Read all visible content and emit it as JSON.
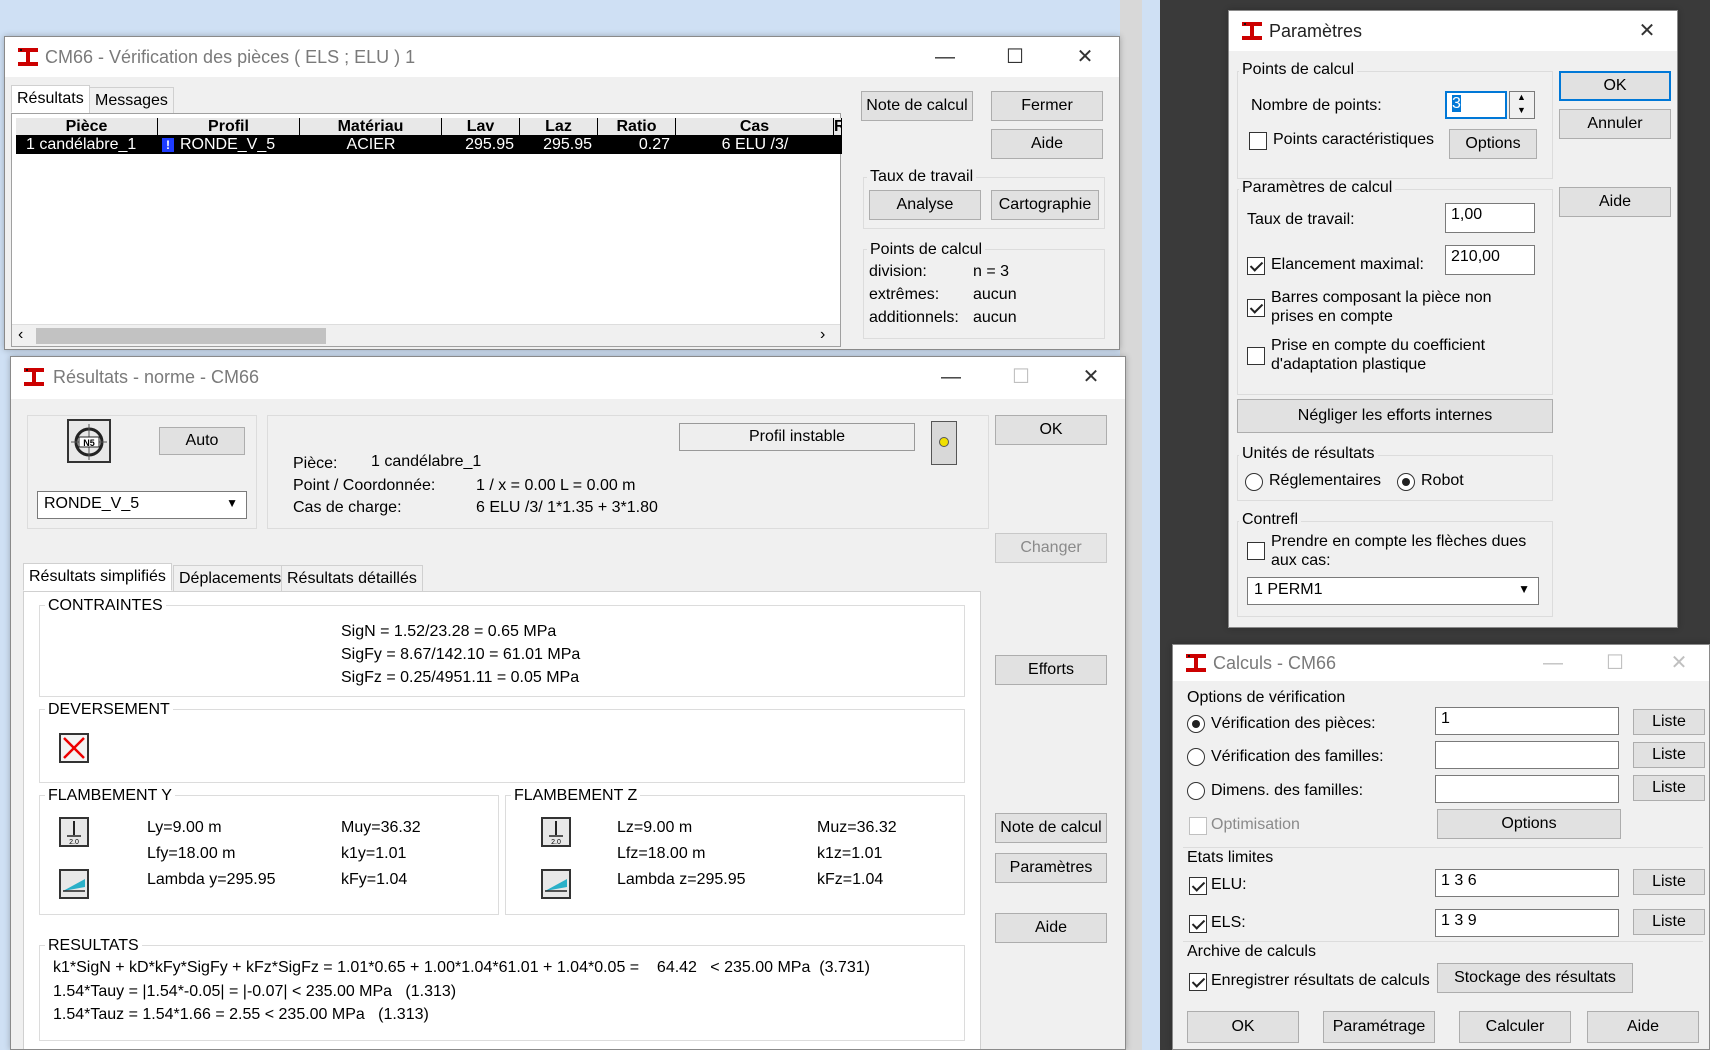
{
  "verif_window": {
    "title": "CM66 - Vérification des pièces ( ELS ; ELU ) 1",
    "tabs": [
      "Résultats",
      "Messages"
    ],
    "columns": [
      "Pièce",
      "Profil",
      "Matériau",
      "Lav",
      "Laz",
      "Ratio",
      "Cas",
      "R"
    ],
    "row": {
      "piece": "1  candélabre_1",
      "warn": "!",
      "profil": "RONDE_V_5",
      "materiau": "ACIER",
      "lav": "295.95",
      "laz": "295.95",
      "ratio": "0.27",
      "cas": "6 ELU /3/"
    },
    "buttons": {
      "note": "Note de calcul",
      "fermer": "Fermer",
      "aide": "Aide",
      "analyse": "Analyse",
      "carto": "Cartographie"
    },
    "taux_label": "Taux de travail",
    "points": {
      "title": "Points de calcul",
      "division_label": "division:",
      "division_value": "n = 3",
      "extremes_label": "extrêmes:",
      "extremes_value": "aucun",
      "add_label": "additionnels:",
      "add_value": "aucun"
    }
  },
  "results_window": {
    "title": "Résultats - norme - CM66",
    "auto": "Auto",
    "profile_select": "RONDE_V_5",
    "profile_status": "Profil instable",
    "info": {
      "piece_label": "Pièce:",
      "piece_value": "1  candélabre_1",
      "point_label": "Point / Coordonnée:",
      "point_value": "1 / x = 0.00 L = 0.00 m",
      "cas_label": "Cas de charge:",
      "cas_value": "6 ELU /3/  1*1.35 + 3*1.80"
    },
    "tabs": [
      "Résultats simplifiés",
      "Déplacements",
      "Résultats détaillés"
    ],
    "contraintes": {
      "title": "CONTRAINTES",
      "lines": [
        "SigN = 1.52/23.28 = 0.65 MPa",
        "SigFy = 8.67/142.10 = 61.01 MPa",
        "SigFz = 0.25/4951.11 = 0.05 MPa"
      ]
    },
    "deversement": {
      "title": "DEVERSEMENT"
    },
    "flambement_y": {
      "title": "FLAMBEMENT Y",
      "l": "Ly=9.00 m",
      "lf": "Lfy=18.00 m",
      "lambda": "Lambda y=295.95",
      "mu": "Muy=36.32",
      "k1": "k1y=1.01",
      "kf": "kFy=1.04"
    },
    "flambement_z": {
      "title": "FLAMBEMENT Z",
      "l": "Lz=9.00 m",
      "lf": "Lfz=18.00 m",
      "lambda": "Lambda z=295.95",
      "mu": "Muz=36.32",
      "k1": "k1z=1.01",
      "kf": "kFz=1.04"
    },
    "resultats": {
      "title": "RESULTATS",
      "lines": [
        "k1*SigN + kD*kFy*SigFy + kFz*SigFz = 1.01*0.65 + 1.00*1.04*61.01 + 1.04*0.05 =    64.42   < 235.00 MPa  (3.731)",
        "1.54*Tauy = |1.54*-0.05| = |-0.07| < 235.00 MPa   (1.313)",
        "1.54*Tauz = 1.54*1.66 = 2.55 < 235.00 MPa   (1.313)"
      ]
    },
    "buttons": {
      "ok": "OK",
      "changer": "Changer",
      "efforts": "Efforts",
      "note": "Note de calcul",
      "parametres": "Paramètres",
      "aide": "Aide"
    }
  },
  "params_window": {
    "title": "Paramètres",
    "points_group": "Points de calcul",
    "nb_points_label": "Nombre de points:",
    "nb_points_value": "3",
    "pts_caract": "Points caractéristiques",
    "options": "Options",
    "calc_group": "Paramètres de calcul",
    "taux_label": "Taux de travail:",
    "taux_value": "1,00",
    "elancement_label": "Elancement maximal:",
    "elancement_value": "210,00",
    "barres_label_1": "Barres composant la pièce non",
    "barres_label_2": "prises en compte",
    "prise_label_1": "Prise en compte du coefficient",
    "prise_label_2": "d'adaptation plastique",
    "negliger": "Négliger les efforts internes",
    "unites_group": "Unités de résultats",
    "reglementaires": "Réglementaires",
    "robot": "Robot",
    "contrefl_group": "Contrefl",
    "prendre_1": "Prendre en compte les flèches dues",
    "prendre_2": "aux cas:",
    "cas_select": "1  PERM1",
    "buttons": {
      "ok": "OK",
      "annuler": "Annuler",
      "aide": "Aide"
    }
  },
  "calc_window": {
    "title": "Calculs - CM66",
    "options_group": "Options de vérification",
    "verif_pieces": "Vérification des pièces:",
    "verif_pieces_value": "1",
    "verif_familles": "Vérification des familles:",
    "dimens": "Dimens. des familles:",
    "optimisation": "Optimisation",
    "options": "Options",
    "etats_group": "Etats limites",
    "elu_label": "ELU:",
    "elu_value": "1 3 6",
    "els_label": "ELS:",
    "els_value": "1 3 9",
    "archive_group": "Archive de calculs",
    "enregistrer": "Enregistrer résultats de calculs",
    "stockage": "Stockage des résultats",
    "liste": "Liste",
    "buttons": {
      "ok": "OK",
      "parametrage": "Paramétrage",
      "calculer": "Calculer",
      "aide": "Aide"
    }
  }
}
